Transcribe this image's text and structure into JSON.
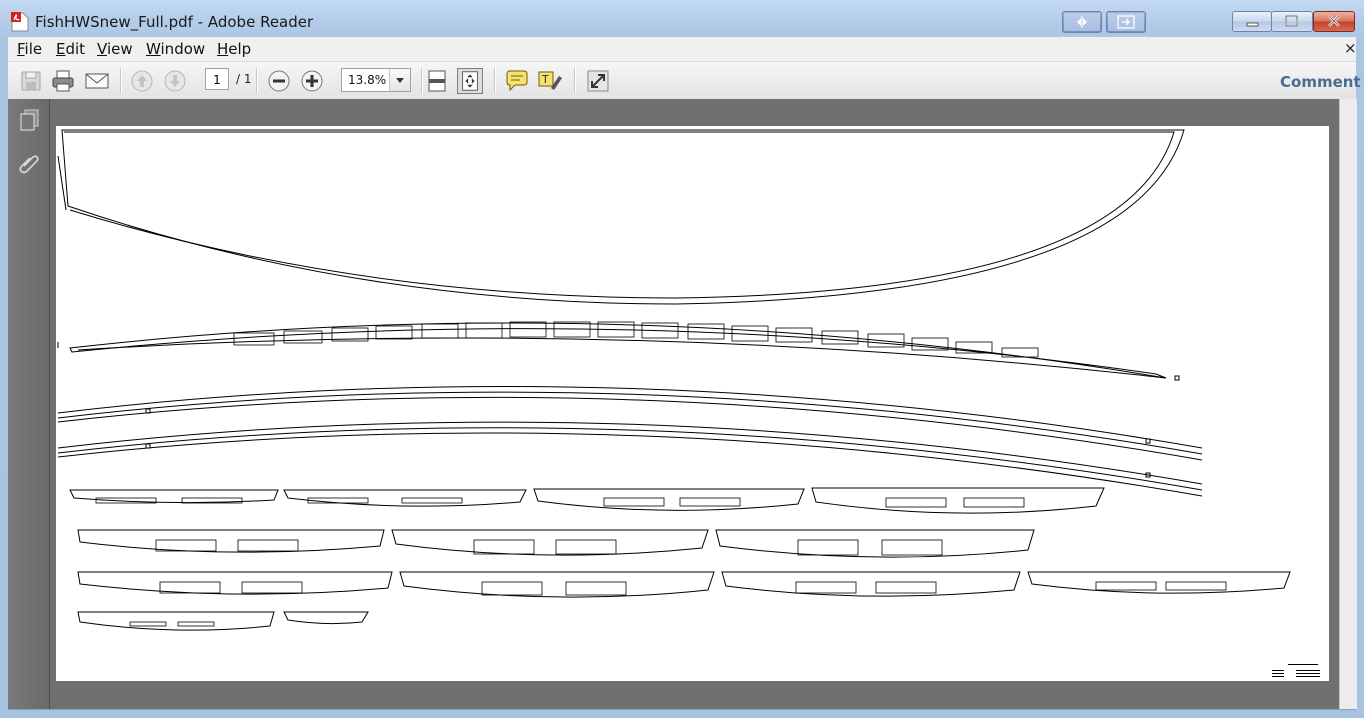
{
  "window": {
    "title": "FishHWSnew_Full.pdf - Adobe Reader",
    "app_icon": "adobe-reader-pdf-icon",
    "caption_buttons": [
      "minimize",
      "maximize",
      "close"
    ],
    "mode_buttons": [
      "read-mode-icon",
      "full-screen-icon"
    ]
  },
  "menubar": {
    "items": [
      {
        "label": "File",
        "mnemonic": "F"
      },
      {
        "label": "Edit",
        "mnemonic": "E"
      },
      {
        "label": "View",
        "mnemonic": "V"
      },
      {
        "label": "Window",
        "mnemonic": "W"
      },
      {
        "label": "Help",
        "mnemonic": "H"
      }
    ],
    "close_document": "×"
  },
  "toolbar": {
    "page_current": "1",
    "page_total": "/ 1",
    "zoom": "13.8%",
    "comment_label": "Comment",
    "icons": [
      "save-icon",
      "print-icon",
      "email-icon",
      "previous-page-icon",
      "next-page-icon",
      "zoom-out-icon",
      "zoom-in-icon",
      "scrolling-mode-icon",
      "fit-page-icon",
      "sticky-note-icon",
      "highlight-text-icon",
      "expand-icon"
    ]
  },
  "navpanel": {
    "icons": [
      "pages-icon",
      "attachments-icon"
    ]
  },
  "colors": {
    "frame": "#aac6e4",
    "document_background": "#707070",
    "page": "#ffffff",
    "nav_panel": "#6f6f6f",
    "comment_link": "#4a6b93",
    "close_button": "#c2432a"
  }
}
